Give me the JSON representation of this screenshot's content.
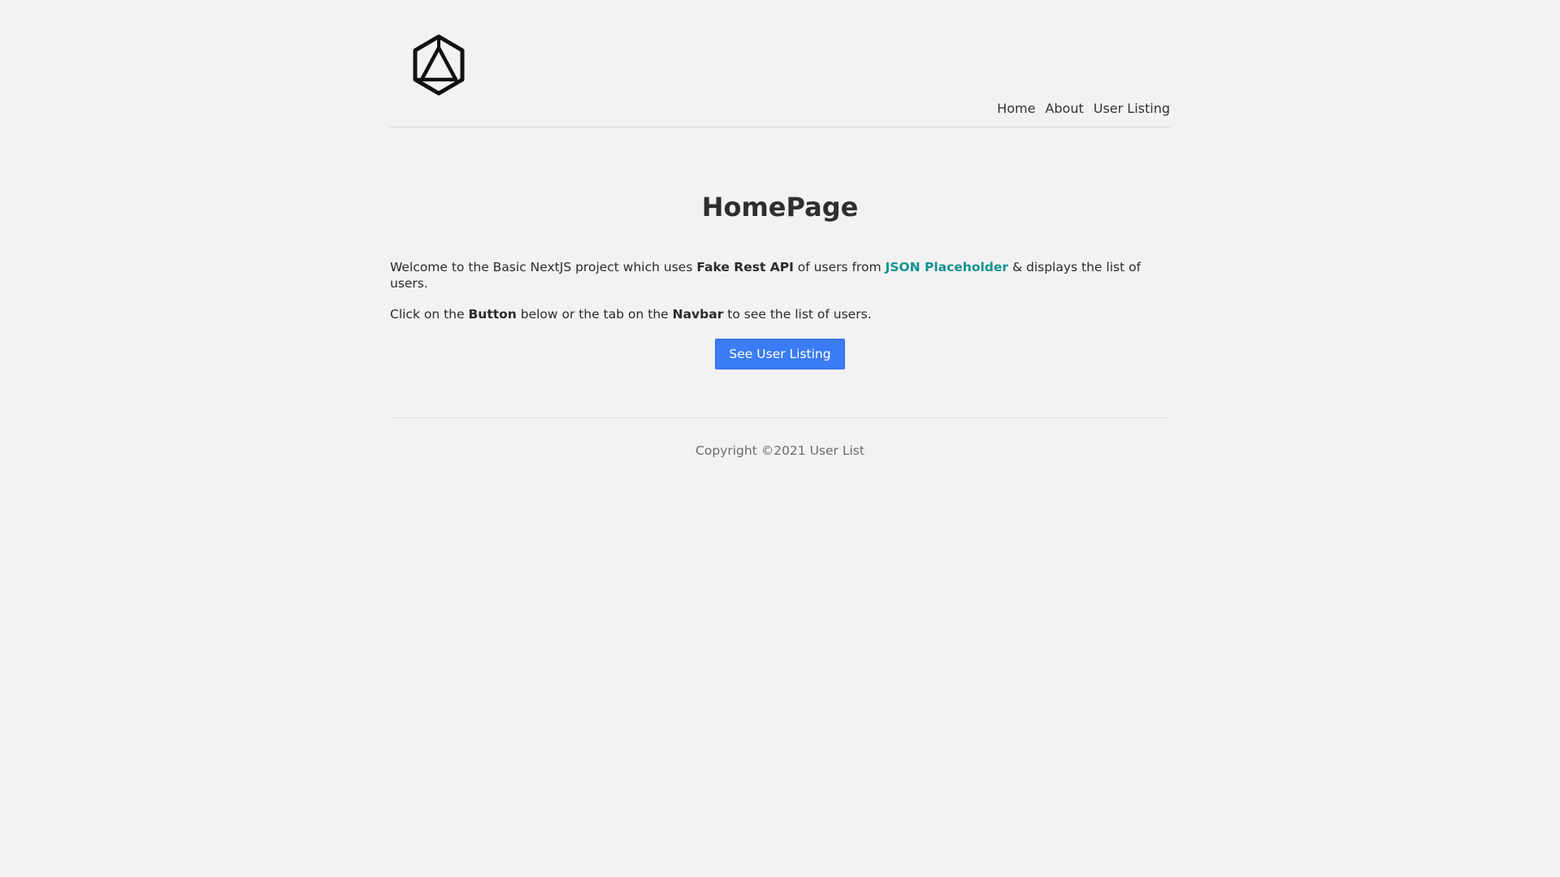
{
  "header": {
    "logo_icon": "hexagon-triangle-logo-icon",
    "nav": [
      {
        "label": "Home"
      },
      {
        "label": "About"
      },
      {
        "label": "User Listing"
      }
    ]
  },
  "main": {
    "title": "HomePage",
    "paragraph1": {
      "text1": "Welcome to the Basic NextJS project which uses ",
      "bold1": "Fake Rest API",
      "text2": " of users from ",
      "link": "JSON Placeholder",
      "text3": " & displays the list of users."
    },
    "paragraph2": {
      "text1": "Click on the ",
      "bold1": "Button",
      "text2": " below or the tab on the ",
      "bold2": "Navbar",
      "text3": " to see the list of users."
    },
    "button_label": "See User Listing"
  },
  "footer": {
    "copyright": "Copyright ©2021 User List"
  },
  "colors": {
    "background": "#f2f2f2",
    "accent_link": "#16928e",
    "button": "#3b7cf5"
  }
}
